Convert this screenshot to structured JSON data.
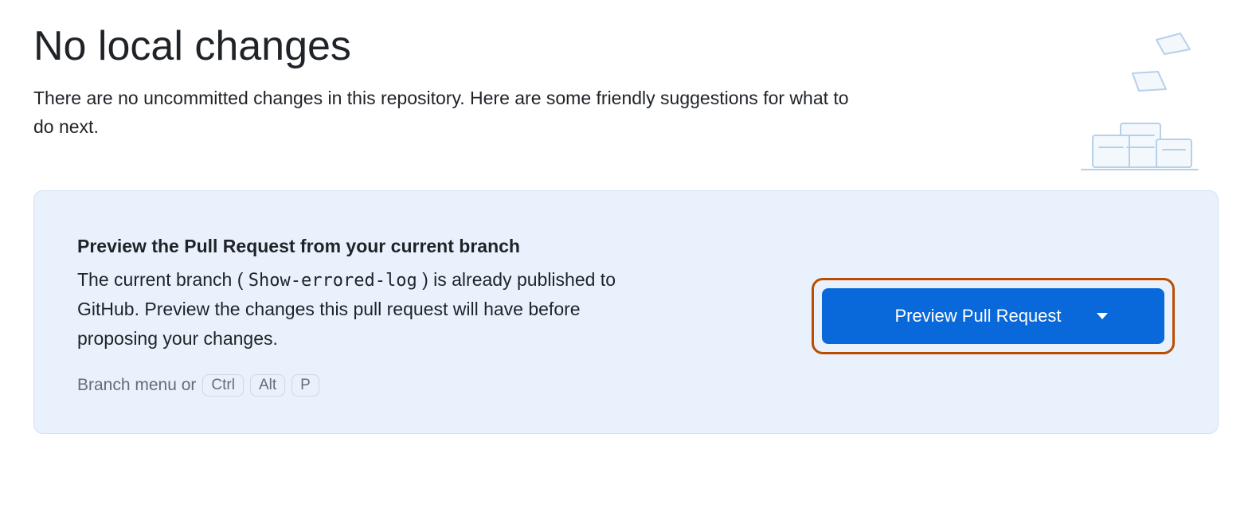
{
  "header": {
    "title": "No local changes",
    "subtitle": "There are no uncommitted changes in this repository. Here are some friendly suggestions for what to do next."
  },
  "card": {
    "title": "Preview the Pull Request from your current branch",
    "body_prefix": "The current branch ( ",
    "branch_name": "Show-errored-log",
    "body_suffix": " ) is already published to GitHub. Preview the changes this pull request will have before proposing your changes.",
    "shortcut_prefix": "Branch menu or",
    "shortcut_keys": [
      "Ctrl",
      "Alt",
      "P"
    ],
    "primary_button_label": "Preview Pull Request"
  },
  "colors": {
    "card_bg": "#e9f2fc",
    "accent": "#0969da",
    "highlight": "#bc4c00"
  }
}
